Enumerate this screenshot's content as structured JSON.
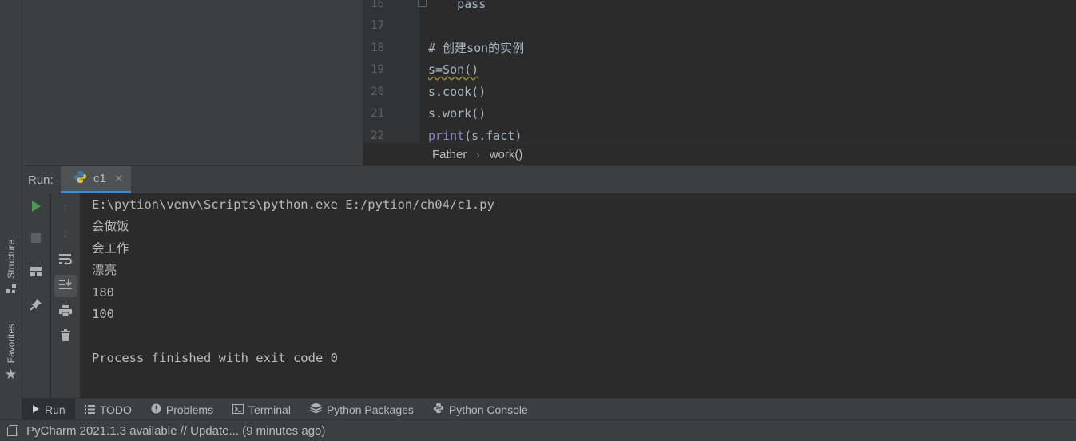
{
  "sidebar": {
    "structure_label": "Structure",
    "favorites_label": "Favorites"
  },
  "editor": {
    "lines": [
      {
        "num": "16",
        "text": "    pass"
      },
      {
        "num": "17",
        "text": ""
      },
      {
        "num": "18",
        "text": "# 创建son的实例"
      },
      {
        "num": "19",
        "text": "s=Son()"
      },
      {
        "num": "20",
        "text": "s.cook()"
      },
      {
        "num": "21",
        "text": "s.work()"
      },
      {
        "num": "22",
        "text_builtin": "print",
        "text_rest": "(s.fact)"
      }
    ]
  },
  "breadcrumb": {
    "items": [
      "Father",
      "work()"
    ]
  },
  "run_panel": {
    "label": "Run:",
    "tab_name": "c1"
  },
  "console": {
    "lines": [
      "E:\\pytion\\venv\\Scripts\\python.exe E:/pytion/ch04/c1.py",
      "会做饭",
      "会工作",
      "漂亮",
      "180",
      "100",
      "",
      "Process finished with exit code 0"
    ]
  },
  "bottom_tabs": {
    "run": "Run",
    "todo": "TODO",
    "problems": "Problems",
    "terminal": "Terminal",
    "python_packages": "Python Packages",
    "python_console": "Python Console"
  },
  "status_bar": {
    "message": "PyCharm 2021.1.3 available // Update... (9 minutes ago)"
  },
  "colors": {
    "run_green": "#499c54",
    "tab_underline": "#4a88c7",
    "keyword_orange": "#cc7832",
    "builtin_purple": "#8888c6"
  }
}
